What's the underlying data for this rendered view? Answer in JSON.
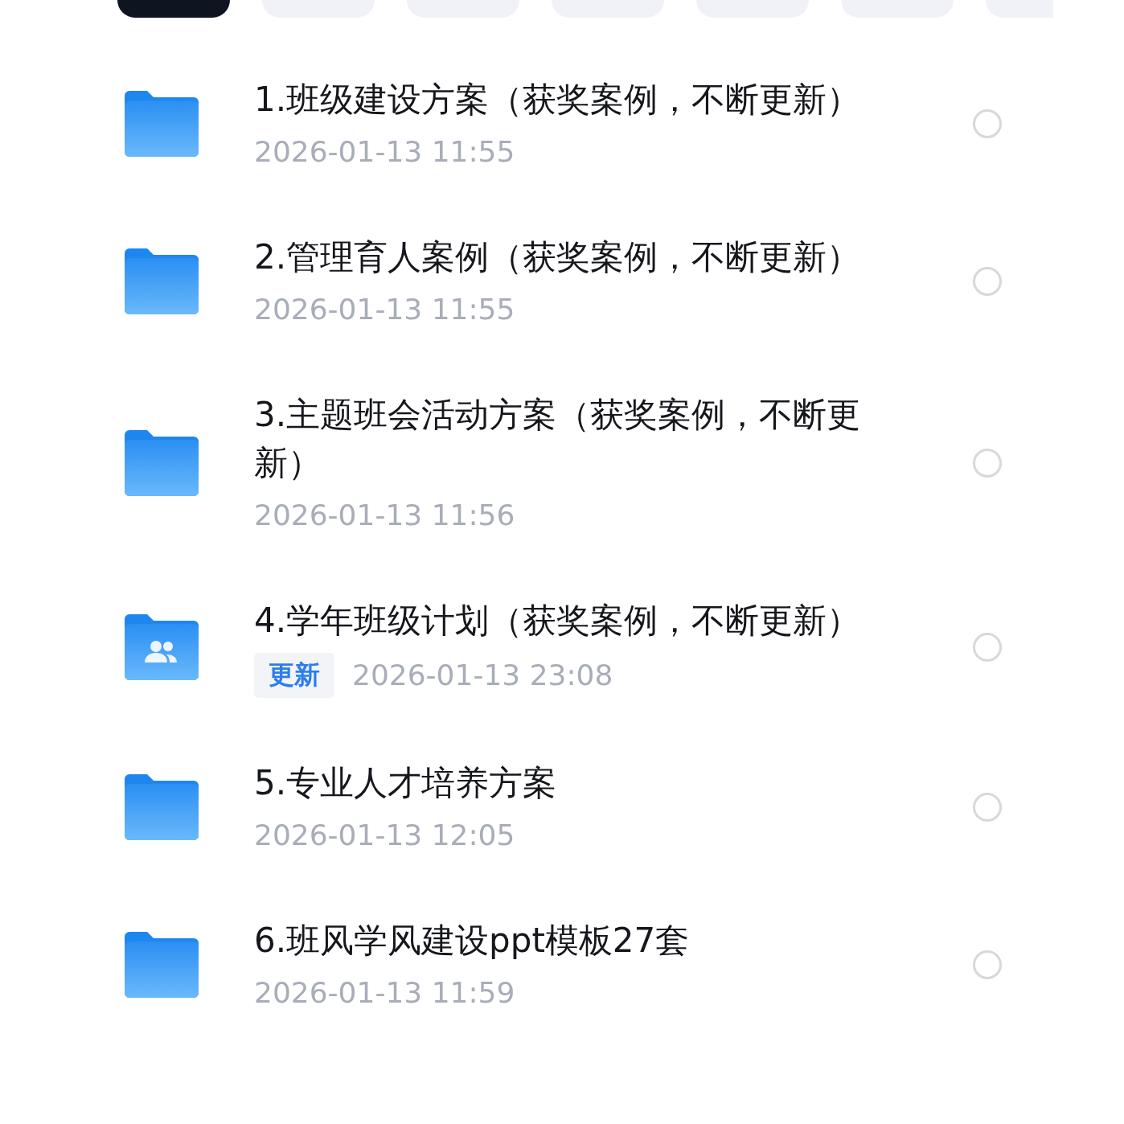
{
  "tabs": [
    {
      "selected": true
    },
    {
      "selected": false
    },
    {
      "selected": false
    },
    {
      "selected": false
    },
    {
      "selected": false
    },
    {
      "selected": false
    },
    {
      "selected": false
    }
  ],
  "files": [
    {
      "kind": "folder",
      "title": "1.班级建设方案（获奖案例，不断更新）",
      "date": "2026-01-13  11:55",
      "selected": false
    },
    {
      "kind": "folder",
      "title": "2.管理育人案例（获奖案例，不断更新）",
      "date": "2026-01-13  11:55",
      "selected": false
    },
    {
      "kind": "folder",
      "title": "3.主题班会活动方案（获奖案例，不断更新）",
      "date": "2026-01-13  11:56",
      "selected": false
    },
    {
      "kind": "shared_folder",
      "badge": "更新",
      "title": "4.学年班级计划（获奖案例，不断更新）",
      "date": "2026-01-13  23:08",
      "selected": false
    },
    {
      "kind": "folder",
      "title": "5.专业人才培养方案",
      "date": "2026-01-13  12:05",
      "selected": false
    },
    {
      "kind": "folder",
      "title": "6.班风学风建设ppt模板27套",
      "date": "2026-01-13  11:59",
      "selected": false
    }
  ]
}
